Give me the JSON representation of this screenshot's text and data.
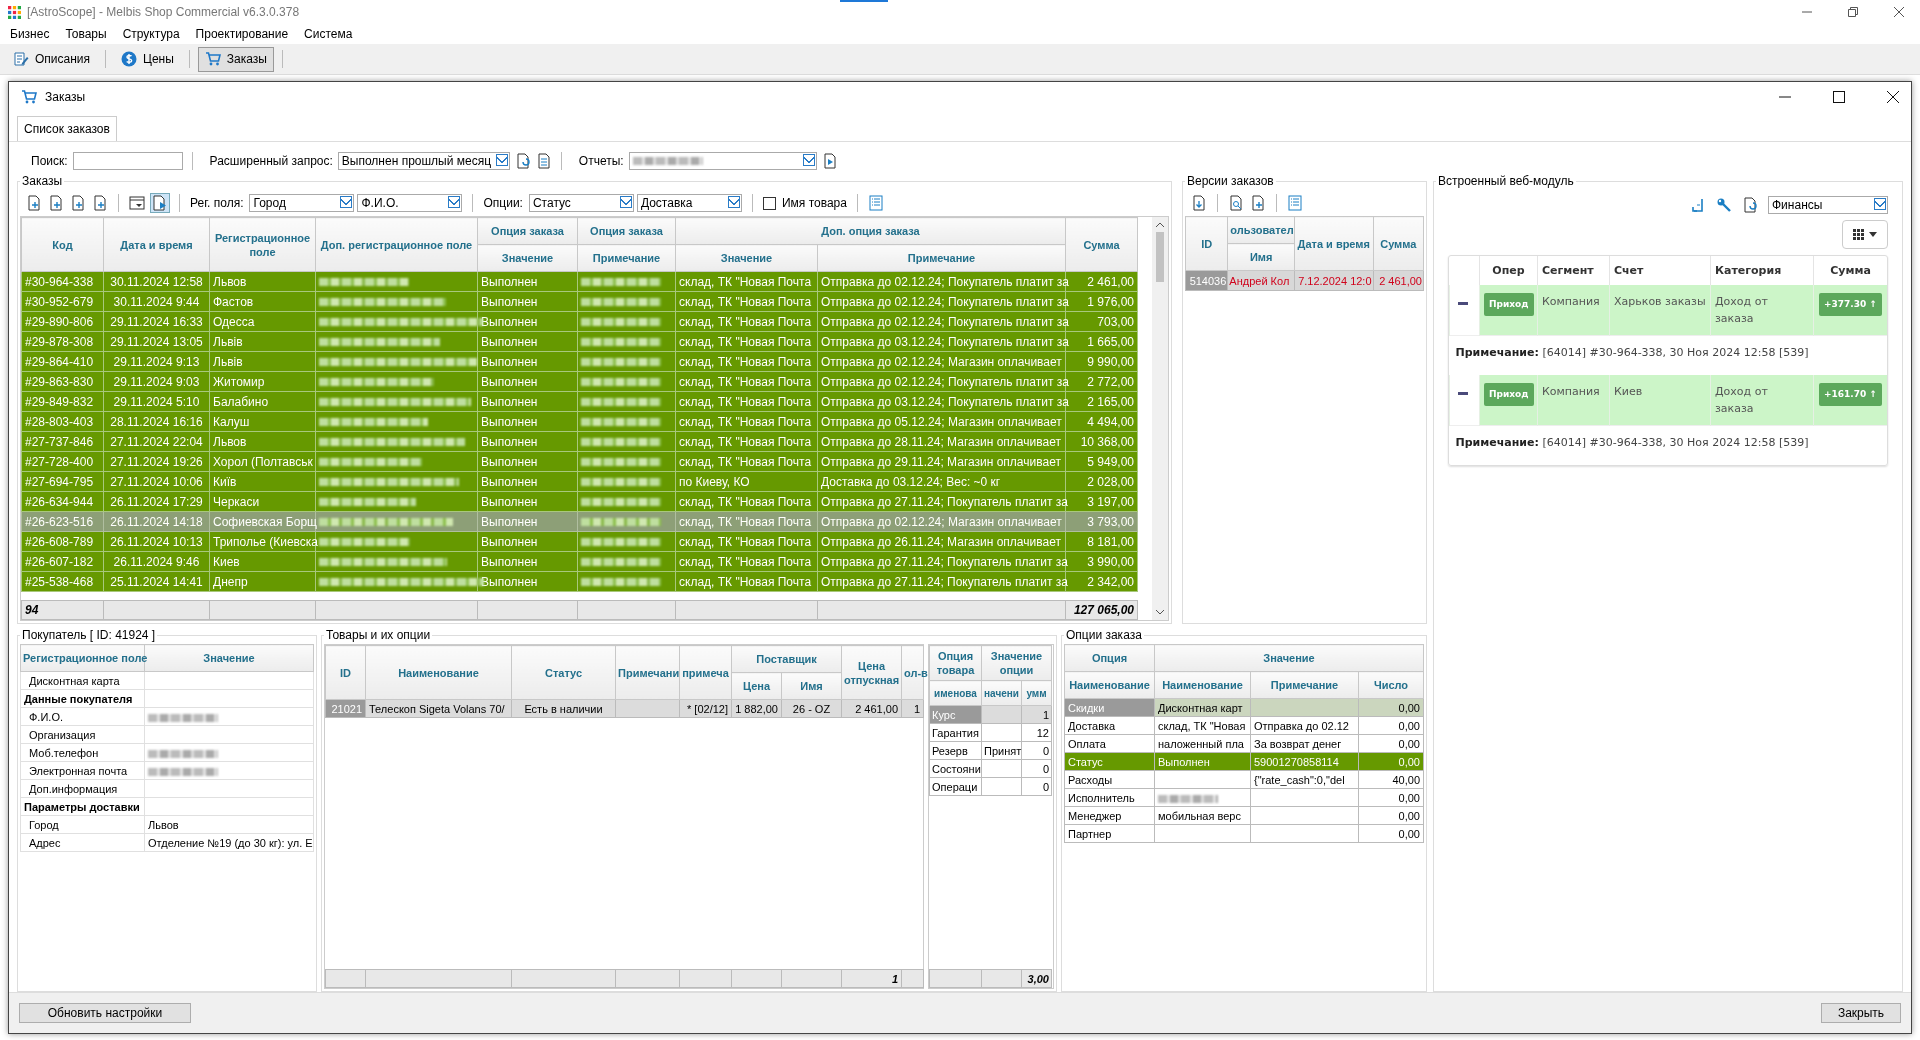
{
  "app": {
    "title": "[AstroScope] - Melbis Shop Commercial v6.3.0.378"
  },
  "menu": [
    "Бизнес",
    "Товары",
    "Структура",
    "Проектирование",
    "Система"
  ],
  "toolbar": [
    {
      "label": "Описания",
      "selected": false
    },
    {
      "label": "Цены",
      "selected": false
    },
    {
      "label": "Заказы",
      "selected": true
    }
  ],
  "window": {
    "title": "Заказы"
  },
  "tabs": [
    {
      "label": "Список заказов",
      "selected": true
    }
  ],
  "filters": {
    "search_label": "Поиск:",
    "query_label": "Расширенный запрос:",
    "query_value": "Выполнен прошлый месяц",
    "reports_label": "Отчеты:"
  },
  "orders": {
    "legend": "Заказы",
    "reg_label": "Рег. поля:",
    "reg_fields": [
      "Город",
      "Ф.И.О."
    ],
    "options_label": "Опции:",
    "options": [
      "Статус",
      "Доставка"
    ],
    "product_name": {
      "label": "Имя товара",
      "checked": false
    },
    "columns": {
      "code": "Код",
      "datetime": "Дата и время",
      "reg": "Регистрационное поле",
      "extra_reg": "Доп. регистрационное поле",
      "opt1": "Опция заказа",
      "opt1_sub": "Значение",
      "opt2": "Опция заказа",
      "opt2_sub": "Примечание",
      "extra_opt": "Доп. опция заказа",
      "extra_opt_value": "Значение",
      "extra_opt_note": "Примечание",
      "sum": "Сумма"
    },
    "rows": [
      {
        "code": "#30-964-338",
        "datetime": "30.11.2024 12:58",
        "reg": "Львов",
        "status": "Выполнен",
        "delivery": "склад, ТК \"Новая Почта",
        "note": "Отправка до 02.12.24; Покупатель платит за",
        "sum": "2 461,00",
        "selected": false
      },
      {
        "code": "#30-952-679",
        "datetime": "30.11.2024 9:44",
        "reg": "Фастов",
        "status": "Выполнен",
        "delivery": "склад, ТК \"Новая Почта",
        "note": "Отправка до 02.12.24; Покупатель платит за",
        "sum": "1 976,00",
        "selected": false
      },
      {
        "code": "#29-890-806",
        "datetime": "29.11.2024 16:33",
        "reg": "Одесса",
        "status": "Выполнен",
        "delivery": "склад, ТК \"Новая Почта",
        "note": "Отправка до 02.12.24; Покупатель платит за",
        "sum": "703,00",
        "selected": false
      },
      {
        "code": "#29-878-308",
        "datetime": "29.11.2024 13:05",
        "reg": "Львів",
        "status": "Выполнен",
        "delivery": "склад, ТК \"Новая Почта",
        "note": "Отправка до 03.12.24; Покупатель платит за",
        "sum": "1 665,00",
        "selected": false
      },
      {
        "code": "#29-864-410",
        "datetime": "29.11.2024 9:13",
        "reg": "Львів",
        "status": "Выполнен",
        "delivery": "склад, ТК \"Новая Почта",
        "note": "Отправка до 02.12.24; Магазин оплачивает",
        "sum": "9 990,00",
        "selected": false
      },
      {
        "code": "#29-863-830",
        "datetime": "29.11.2024 9:03",
        "reg": "Житомир",
        "status": "Выполнен",
        "delivery": "склад, ТК \"Новая Почта",
        "note": "Отправка до 02.12.24; Покупатель платит за",
        "sum": "2 772,00",
        "selected": false
      },
      {
        "code": "#29-849-832",
        "datetime": "29.11.2024 5:10",
        "reg": "Балабино",
        "status": "Выполнен",
        "delivery": "склад, ТК \"Новая Почта",
        "note": "Отправка до 03.12.24; Покупатель платит за",
        "sum": "2 165,00",
        "selected": false
      },
      {
        "code": "#28-803-403",
        "datetime": "28.11.2024 16:16",
        "reg": "Калуш",
        "status": "Выполнен",
        "delivery": "склад, ТК \"Новая Почта",
        "note": "Отправка до 05.12.24; Магазин оплачивает",
        "sum": "4 494,00",
        "selected": false
      },
      {
        "code": "#27-737-846",
        "datetime": "27.11.2024 22:04",
        "reg": "Львов",
        "status": "Выполнен",
        "delivery": "склад, ТК \"Новая Почта",
        "note": "Отправка до 28.11.24; Магазин оплачивает",
        "sum": "10 368,00",
        "selected": false
      },
      {
        "code": "#27-728-400",
        "datetime": "27.11.2024 19:26",
        "reg": "Хорол (Полтавськ",
        "status": "Выполнен",
        "delivery": "склад, ТК \"Новая Почта",
        "note": "Отправка до 29.11.24; Магазин оплачивает",
        "sum": "5 949,00",
        "selected": false
      },
      {
        "code": "#27-694-795",
        "datetime": "27.11.2024 10:06",
        "reg": "Київ",
        "status": "Выполнен",
        "delivery": "по Киеву, КО",
        "note": "Доставка до 03.12.24; Вес: ~0 кг",
        "sum": "2 028,00",
        "selected": false
      },
      {
        "code": "#26-634-944",
        "datetime": "26.11.2024 17:29",
        "reg": "Черкаси",
        "status": "Выполнен",
        "delivery": "склад, ТК \"Новая Почта",
        "note": "Отправка до 27.11.24; Покупатель платит за",
        "sum": "3 197,00",
        "selected": false
      },
      {
        "code": "#26-623-516",
        "datetime": "26.11.2024 14:18",
        "reg": "Софиевская Борщ",
        "status": "Выполнен",
        "delivery": "склад, ТК \"Новая Почта",
        "note": "Отправка до 02.12.24; Магазин оплачивает",
        "sum": "3 793,00",
        "selected": true
      },
      {
        "code": "#26-608-789",
        "datetime": "26.11.2024 10:13",
        "reg": "Триполье (Киевска",
        "status": "Выполнен",
        "delivery": "склад, ТК \"Новая Почта",
        "note": "Отправка до 26.11.24; Магазин оплачивает",
        "sum": "8 181,00",
        "selected": false
      },
      {
        "code": "#26-607-182",
        "datetime": "26.11.2024 9:46",
        "reg": "Киев",
        "status": "Выполнен",
        "delivery": "склад, ТК \"Новая Почта",
        "note": "Отправка до 27.11.24; Покупатель платит за",
        "sum": "3 990,00",
        "selected": false
      },
      {
        "code": "#25-538-468",
        "datetime": "25.11.2024 14:41",
        "reg": "Днепр",
        "status": "Выполнен",
        "delivery": "склад, ТК \"Новая Почта",
        "note": "Отправка до 27.11.24; Покупатель платит за",
        "sum": "2 342,00",
        "selected": false
      }
    ],
    "footer": {
      "count": "94",
      "total": "127 065,00"
    }
  },
  "versions": {
    "legend": "Версии заказов",
    "columns": {
      "id": "ID",
      "user": "ользовател",
      "name": "Имя",
      "datetime": "Дата и время",
      "sum": "Сумма"
    },
    "rows": [
      {
        "id": "514036",
        "name": "Андрей Кол",
        "datetime": "7.12.2024 12:0",
        "sum": "2 461,00",
        "selected": true
      }
    ]
  },
  "web_module": {
    "legend": "Встроенный веб-модуль",
    "select": "Финансы",
    "columns": [
      "Опер",
      "Сегмент",
      "Счет",
      "Категория",
      "Сумма"
    ],
    "entries": [
      {
        "op": "Приход",
        "segment": "Компания",
        "account": "Харьков заказы",
        "category": "Доход от заказа",
        "amount": "+377.30 ↑",
        "note_label": "Примечание:",
        "note": "[64014] #30-964-338, 30 Ноя 2024 12:58 [539]"
      },
      {
        "op": "Приход",
        "segment": "Компания",
        "account": "Киев",
        "category": "Доход от заказа",
        "amount": "+161.70 ↑",
        "note_label": "Примечание:",
        "note": "[64014] #30-964-338, 30 Ноя 2024 12:58 [539]"
      }
    ]
  },
  "buyer": {
    "legend": "Покупатель [ ID: 41924 ]",
    "columns": [
      "Регистрационное поле",
      "Значение"
    ],
    "rows": [
      {
        "kind": "field",
        "label": "Дисконтная карта"
      },
      {
        "kind": "section",
        "label": "Данные покупателя"
      },
      {
        "kind": "field",
        "label": "Ф.И.О.",
        "redacted": true
      },
      {
        "kind": "field",
        "label": "Организация"
      },
      {
        "kind": "field",
        "label": "Моб.телефон",
        "redacted": true
      },
      {
        "kind": "field",
        "label": "Электронная почта",
        "redacted": true
      },
      {
        "kind": "field",
        "label": "Доп.информация"
      },
      {
        "kind": "section",
        "label": "Параметры доставки"
      },
      {
        "kind": "field",
        "label": "Город",
        "value": "Львов"
      },
      {
        "kind": "field",
        "label": "Адрес",
        "value": "Отделение №19 (до 30 кг): ул. Е"
      }
    ]
  },
  "products": {
    "legend": "Товары и их опции",
    "columns": {
      "id": "ID",
      "name": "Наименование",
      "status": "Статус",
      "note": "Примечани",
      "note2": "примеча",
      "supplier": "Поставщик",
      "price": "Цена",
      "supplier_name": "Имя",
      "sale_price": "Цена отпускная",
      "qty": "ол-в"
    },
    "rows": [
      {
        "id": "21021",
        "name": "Телескоп Sigeta Volans 70/",
        "status": "Есть в наличии",
        "note2": "* [02/12]",
        "price": "1 882,00",
        "supplier_name": "26 - OZ",
        "sale_price": "2 461,00",
        "qty": "1",
        "selected": true
      }
    ],
    "footer": "1",
    "options": {
      "columns": {
        "option": "Опция товара",
        "value": "Значение опции",
        "name": "именова",
        "value_sub": "начени",
        "sum": "умм"
      },
      "rows": [
        {
          "name": "Курс",
          "sum": "1",
          "selected": true
        },
        {
          "name": "Гарантия",
          "sum": "12",
          "selected": false
        },
        {
          "name": "Резерв",
          "value": "Принят",
          "sum": "0",
          "selected": false
        },
        {
          "name": "Состояни",
          "sum": "0",
          "selected": false
        },
        {
          "name": "Операци",
          "sum": "0",
          "selected": false
        }
      ],
      "footer": "3,00"
    }
  },
  "order_options": {
    "legend": "Опции заказа",
    "columns": {
      "option": "Опция",
      "value": "Значение",
      "name": "Наименование",
      "value_name": "Наименование",
      "note": "Примечание",
      "number": "Число"
    },
    "rows": [
      {
        "name": "Скидки",
        "value": "Дисконтная карт",
        "number": "0,00",
        "kind": "plain",
        "selected": true
      },
      {
        "name": "Доставка",
        "value": "склад, ТК \"Новая",
        "note": "Отправка до 02.12",
        "number": "0,00",
        "kind": "plain",
        "selected": false
      },
      {
        "name": "Оплата",
        "value": "наложенный пла",
        "note": "За возврат денег",
        "number": "0,00",
        "kind": "plain",
        "selected": false
      },
      {
        "name": "Статус",
        "value": "Выполнен",
        "note": "59001270858114",
        "number": "0,00",
        "kind": "status",
        "selected": false
      },
      {
        "name": "Расходы",
        "note": "{\"rate_cash\":0,\"del",
        "number": "40,00",
        "kind": "plain",
        "selected": false
      },
      {
        "name": "Исполнитель",
        "number": "0,00",
        "kind": "plain",
        "selected": false,
        "redacted": true
      },
      {
        "name": "Менеджер",
        "value": "мобильная верс",
        "number": "0,00",
        "kind": "plain",
        "selected": false
      },
      {
        "name": "Партнер",
        "number": "0,00",
        "kind": "plain",
        "selected": false
      }
    ]
  },
  "buttons": [
    "Обновить настройки",
    "Закрыть"
  ]
}
